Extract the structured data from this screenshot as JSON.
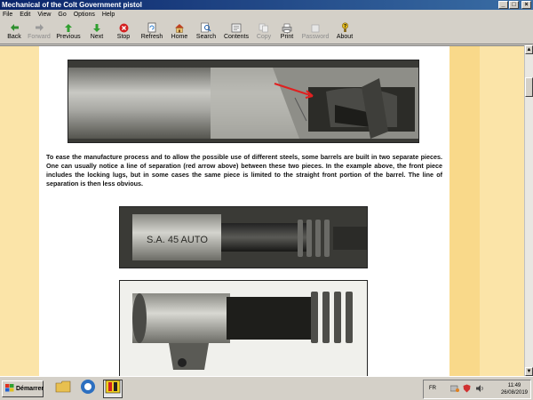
{
  "window": {
    "title": "Mechanical of the Colt Government pistol",
    "controls": [
      "_",
      "□",
      "×"
    ]
  },
  "menu": [
    "File",
    "Edit",
    "View",
    "Go",
    "Options",
    "Help"
  ],
  "toolbar": [
    {
      "label": "Back",
      "icon": "back-arrow-icon",
      "enabled": true
    },
    {
      "label": "Forward",
      "icon": "forward-arrow-icon",
      "enabled": false
    },
    {
      "label": "Previous",
      "icon": "up-arrow-icon",
      "enabled": true
    },
    {
      "label": "Next",
      "icon": "down-arrow-icon",
      "enabled": true
    },
    {
      "label": "Stop",
      "icon": "stop-icon",
      "enabled": true
    },
    {
      "label": "Refresh",
      "icon": "refresh-icon",
      "enabled": true
    },
    {
      "label": "Home",
      "icon": "home-icon",
      "enabled": true
    },
    {
      "label": "Search",
      "icon": "search-icon",
      "enabled": true
    },
    {
      "label": "Contents",
      "icon": "contents-icon",
      "enabled": true
    },
    {
      "label": "Copy",
      "icon": "copy-icon",
      "enabled": false
    },
    {
      "label": "Print",
      "icon": "print-icon",
      "enabled": true
    },
    {
      "label": "Password",
      "icon": "password-icon",
      "enabled": false
    },
    {
      "label": "About",
      "icon": "about-icon",
      "enabled": true
    }
  ],
  "content": {
    "paragraph": "To ease the manufacture process and to allow the possible use of different steels, some barrels are built in two separate pieces. One can usually notice a line of separation (red arrow above) between these two pieces. In the example above, the front piece includes the locking lugs, but in some cases the same piece is limited to the straight front portion of the barrel. The line of separation is then less obvious.",
    "barrel_marking": "S.A. 45 AUTO"
  },
  "colors": {
    "left_band": "#fbe4a8",
    "right_band_dark": "#f9d98a",
    "right_band_light": "#fbe4a8",
    "arrow": "#e02020"
  },
  "taskbar": {
    "start_label": "Démarrer",
    "language": "FR",
    "time": "11:49",
    "date": "26/08/2019"
  }
}
